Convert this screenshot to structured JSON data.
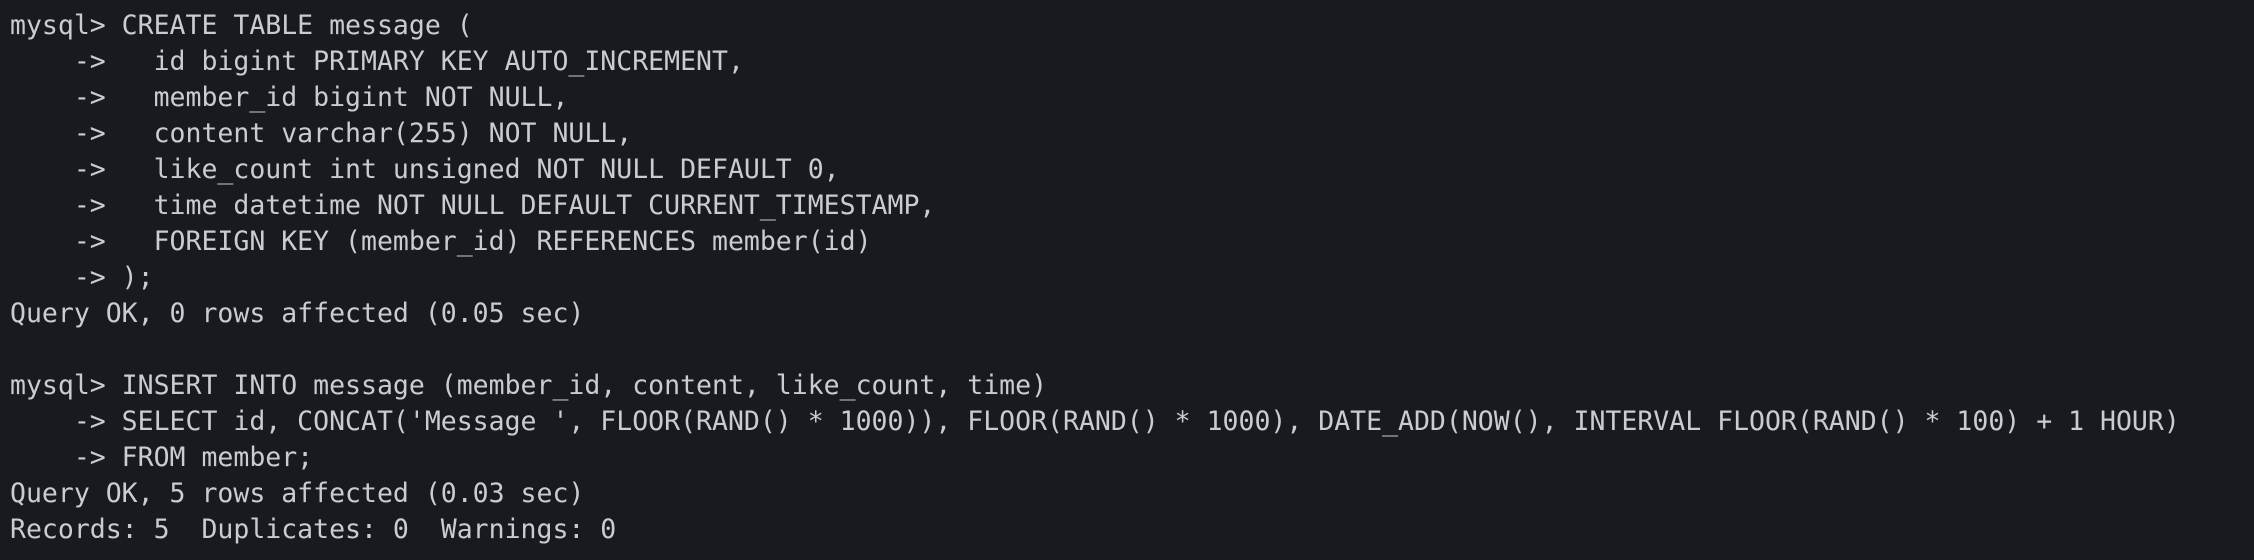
{
  "terminal": {
    "lines": [
      "mysql> CREATE TABLE message (",
      "    ->   id bigint PRIMARY KEY AUTO_INCREMENT,",
      "    ->   member_id bigint NOT NULL,",
      "    ->   content varchar(255) NOT NULL,",
      "    ->   like_count int unsigned NOT NULL DEFAULT 0,",
      "    ->   time datetime NOT NULL DEFAULT CURRENT_TIMESTAMP,",
      "    ->   FOREIGN KEY (member_id) REFERENCES member(id)",
      "    -> );",
      "Query OK, 0 rows affected (0.05 sec)",
      "",
      "mysql> INSERT INTO message (member_id, content, like_count, time)",
      "    -> SELECT id, CONCAT('Message ', FLOOR(RAND() * 1000)), FLOOR(RAND() * 1000), DATE_ADD(NOW(), INTERVAL FLOOR(RAND() * 100) + 1 HOUR)",
      "    -> FROM member;",
      "Query OK, 5 rows affected (0.03 sec)",
      "Records: 5  Duplicates: 0  Warnings: 0"
    ]
  }
}
